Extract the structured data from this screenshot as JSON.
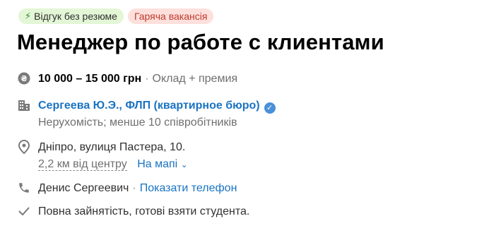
{
  "badges": [
    {
      "label": "Відгук без резюме"
    },
    {
      "label": "Гаряча вакансія"
    }
  ],
  "title": "Менеджер по работе с клиентами",
  "salary": {
    "range": "10 000 – 15 000 грн",
    "separator": "·",
    "note": "Оклад + премия"
  },
  "company": {
    "name": "Сергеева Ю.Э., ФЛП (квартирное бюро)",
    "details": "Нерухомість; менше 10 співробітників"
  },
  "location": {
    "address": "Дніпро, вулиця Пастера, 10.",
    "distance": "2,2 км від центру",
    "map_link": "На мапі"
  },
  "contact": {
    "name": "Денис Сергеевич",
    "separator": "·",
    "phone_link": "Показати телефон"
  },
  "employment": "Повна зайнятість, готові взяти студента.",
  "colors": {
    "link": "#1a73c2",
    "green_badge": "#e3f6d6",
    "red_badge": "#fde0dc",
    "verified": "#4a90d9"
  }
}
